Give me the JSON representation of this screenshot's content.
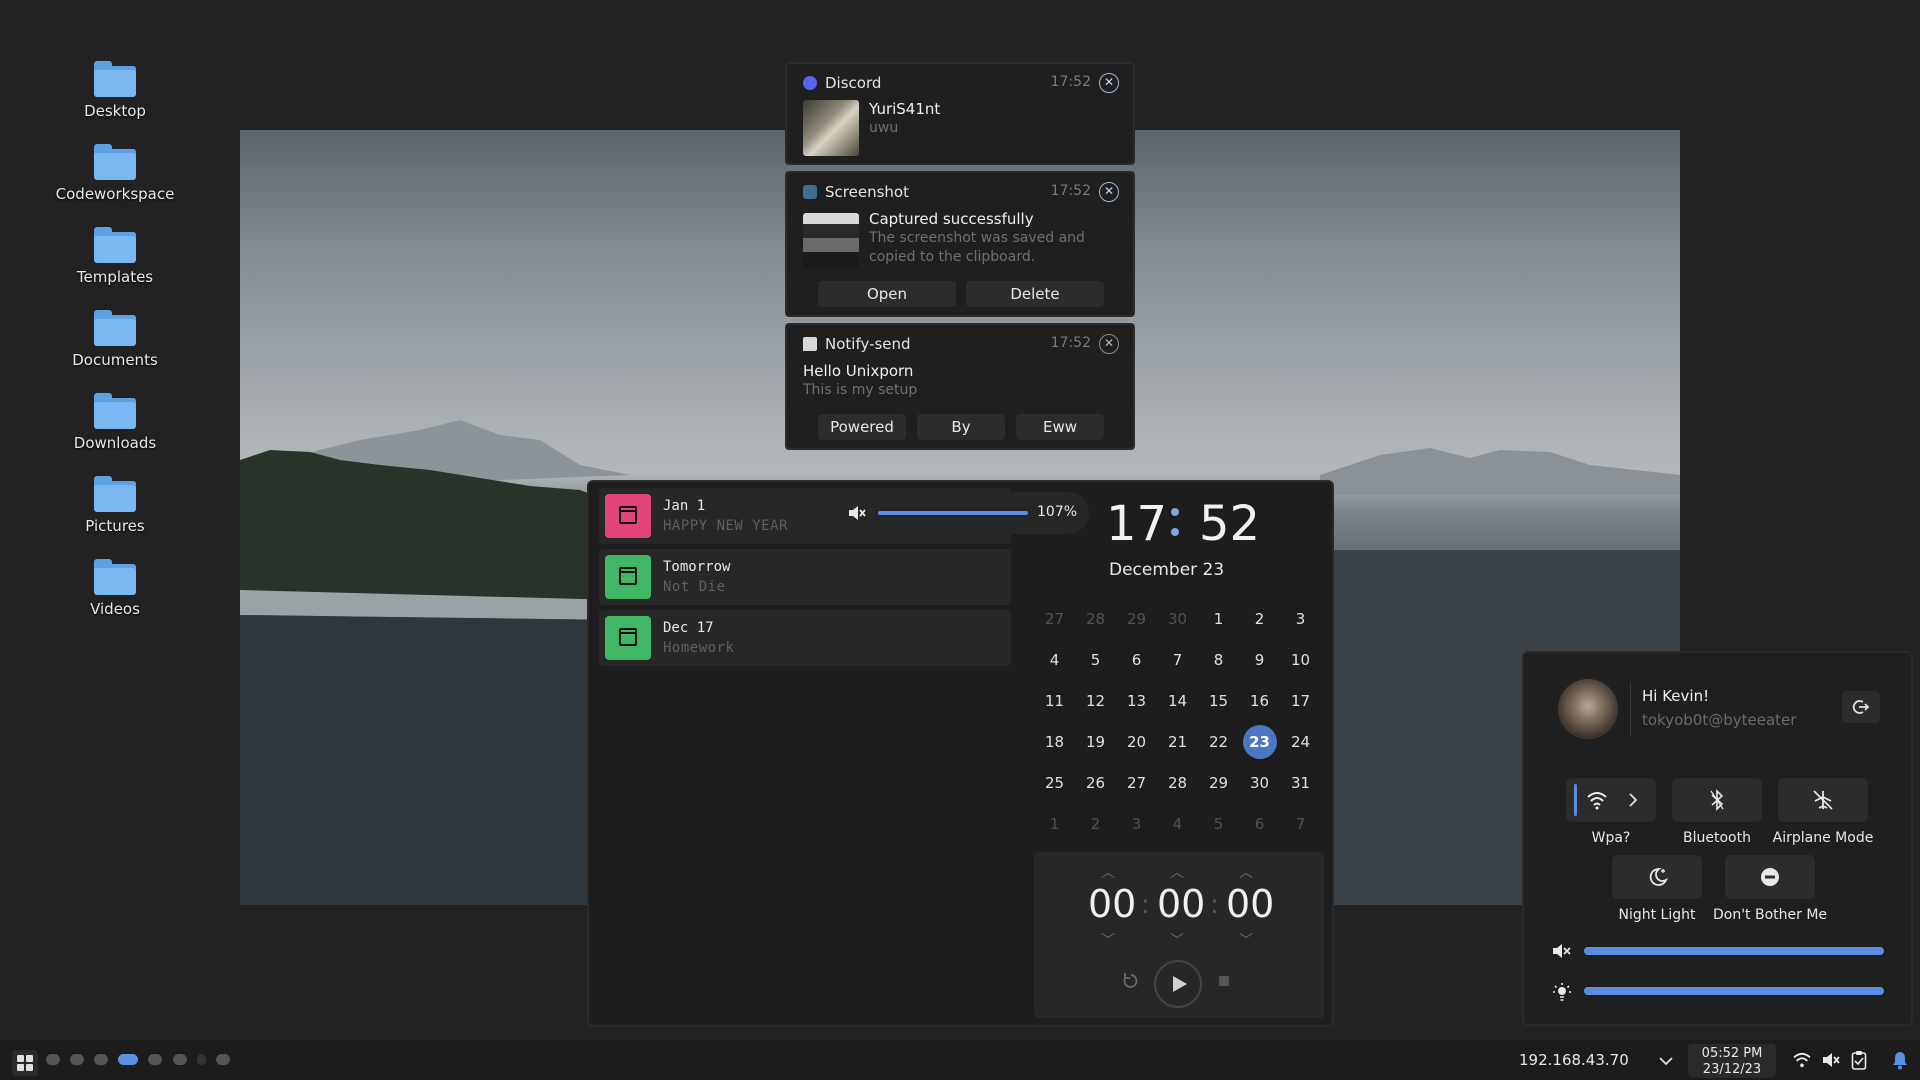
{
  "desktop": {
    "icons": [
      {
        "label": "Desktop"
      },
      {
        "label": "Codeworkspace"
      },
      {
        "label": "Templates"
      },
      {
        "label": "Documents"
      },
      {
        "label": "Downloads"
      },
      {
        "label": "Pictures"
      },
      {
        "label": "Videos"
      }
    ]
  },
  "notifications": [
    {
      "app": "Discord",
      "time": "17:52",
      "title": "YuriS41nt",
      "body": "uwu",
      "icon": "discord-icon",
      "color": "#5865F2"
    },
    {
      "app": "Screenshot",
      "time": "17:52",
      "title": "Captured successfully",
      "body_line1": "The screenshot was saved and",
      "body_line2": "copied to the clipboard.",
      "actions": [
        "Open",
        "Delete"
      ],
      "icon": "camera-icon"
    },
    {
      "app": "Notify-send",
      "time": "17:52",
      "title": "Hello Unixporn",
      "body": "This is my setup",
      "actions": [
        "Powered",
        "By",
        "Eww"
      ],
      "icon": "message-icon"
    }
  ],
  "dashboard": {
    "events": [
      {
        "title": "Jan 1",
        "subtitle": "HAPPY NEW YEAR",
        "color": "#e2457a"
      },
      {
        "title": "Tomorrow",
        "subtitle": "Not Die",
        "color": "#3fb764"
      },
      {
        "title": "Dec 17",
        "subtitle": "Homework",
        "color": "#3fb764"
      }
    ],
    "volume": {
      "value": "107%",
      "level": 1.0
    },
    "clock": {
      "hours": "17",
      "minutes": "52"
    },
    "calendar": {
      "date": "December 23",
      "today": "23",
      "rows": [
        [
          [
            "27",
            1
          ],
          [
            "28",
            1
          ],
          [
            "29",
            1
          ],
          [
            "30",
            1
          ],
          [
            "1",
            0
          ],
          [
            "2",
            0
          ],
          [
            "3",
            0
          ]
        ],
        [
          [
            "4",
            0
          ],
          [
            "5",
            0
          ],
          [
            "6",
            0
          ],
          [
            "7",
            0
          ],
          [
            "8",
            0
          ],
          [
            "9",
            0
          ],
          [
            "10",
            0
          ]
        ],
        [
          [
            "11",
            0
          ],
          [
            "12",
            0
          ],
          [
            "13",
            0
          ],
          [
            "14",
            0
          ],
          [
            "15",
            0
          ],
          [
            "16",
            0
          ],
          [
            "17",
            0
          ]
        ],
        [
          [
            "18",
            0
          ],
          [
            "19",
            0
          ],
          [
            "20",
            0
          ],
          [
            "21",
            0
          ],
          [
            "22",
            0
          ],
          [
            "23",
            0
          ],
          [
            "24",
            0
          ]
        ],
        [
          [
            "25",
            0
          ],
          [
            "26",
            0
          ],
          [
            "27",
            0
          ],
          [
            "28",
            0
          ],
          [
            "29",
            0
          ],
          [
            "30",
            0
          ],
          [
            "31",
            0
          ]
        ],
        [
          [
            "1",
            1
          ],
          [
            "2",
            1
          ],
          [
            "3",
            1
          ],
          [
            "4",
            1
          ],
          [
            "5",
            1
          ],
          [
            "6",
            1
          ],
          [
            "7",
            1
          ]
        ]
      ]
    },
    "timer": {
      "h": "00",
      "m": "00",
      "s": "00",
      "sep": ":"
    }
  },
  "quick_settings": {
    "greeting": "Hi Kevin!",
    "user": "tokyob0t@byteeater",
    "toggles": [
      {
        "label": "Wpa?",
        "icon": "wifi-icon",
        "active": true
      },
      {
        "label": "Bluetooth",
        "icon": "bluetooth-icon",
        "active": false
      },
      {
        "label": "Airplane Mode",
        "icon": "airplane-icon",
        "active": false
      },
      {
        "label": "Night Light",
        "icon": "night-light-icon",
        "active": false
      },
      {
        "label": "Don't Bother Me",
        "icon": "do-not-disturb-icon",
        "active": false
      }
    ],
    "volume_level": 1.0,
    "brightness_level": 1.0
  },
  "taskbar": {
    "ip": "192.168.43.70",
    "time": "05:52 PM",
    "date": "23/12/23",
    "workspaces_active": 4
  },
  "colors": {
    "accent": "#4a76c2",
    "slider": "#5a8ee0",
    "panel": "#1d1d1d"
  }
}
